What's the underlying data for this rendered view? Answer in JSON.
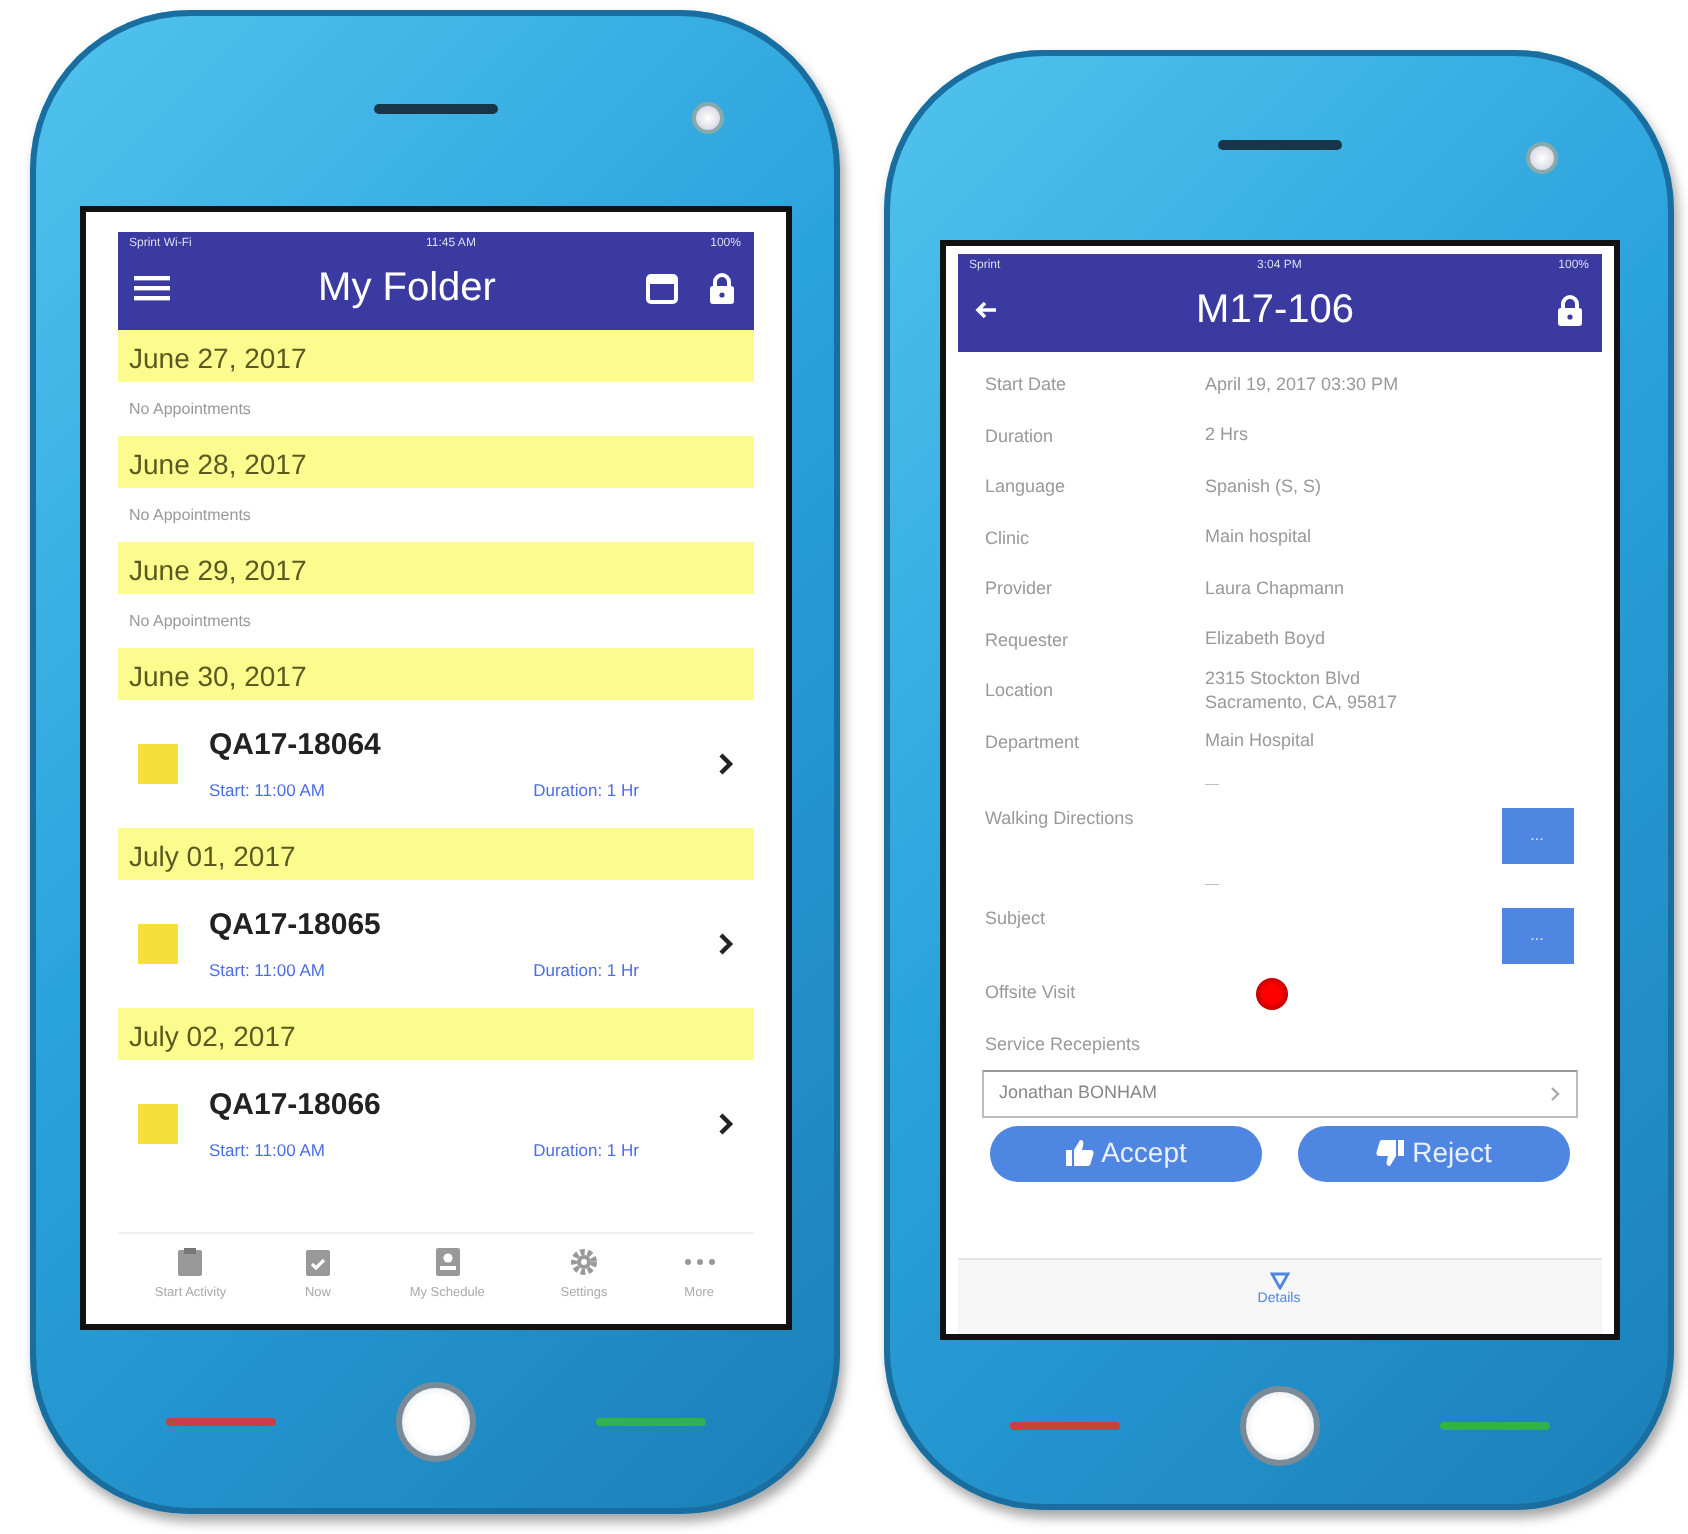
{
  "folder_screen": {
    "status_bar": {
      "carrier": "Sprint Wi-Fi",
      "time": "11:45 AM",
      "battery": "100%"
    },
    "title": "My Folder",
    "days": [
      {
        "date": "June 27, 2017",
        "empty_text": "No Appointments"
      },
      {
        "date": "June 28, 2017",
        "empty_text": "No Appointments"
      },
      {
        "date": "June 29, 2017",
        "empty_text": "No Appointments"
      },
      {
        "date": "June 30, 2017",
        "appointments": [
          {
            "id": "QA17-18064",
            "start": "Start: 11:00 AM",
            "duration": "Duration: 1 Hr",
            "color": "#f7df3a"
          }
        ]
      },
      {
        "date": "July 01, 2017",
        "appointments": [
          {
            "id": "QA17-18065",
            "start": "Start: 11:00 AM",
            "duration": "Duration: 1 Hr",
            "color": "#f7df3a"
          }
        ]
      },
      {
        "date": "July 02, 2017",
        "appointments": [
          {
            "id": "QA17-18066",
            "start": "Start: 11:00 AM",
            "duration": "Duration: 1 Hr",
            "color": "#f7df3a"
          }
        ]
      }
    ],
    "tabs": [
      {
        "label": "Start Activity"
      },
      {
        "label": "Now"
      },
      {
        "label": "My Schedule"
      },
      {
        "label": "Settings"
      },
      {
        "label": "More"
      }
    ]
  },
  "detail_screen": {
    "status_bar": {
      "carrier": "Sprint",
      "time": "3:04 PM",
      "battery": "100%"
    },
    "title": "M17-106",
    "fields": [
      {
        "kind": "text",
        "label": "Start Date",
        "value": "April 19, 2017    03:30 PM"
      },
      {
        "kind": "text",
        "label": "Duration",
        "value": "2 Hrs"
      },
      {
        "kind": "text",
        "label": "Language",
        "value": "Spanish (S, S)"
      },
      {
        "kind": "text",
        "label": "Clinic",
        "value": "Main hospital"
      },
      {
        "kind": "text",
        "label": "Provider",
        "value": "Laura Chapmann"
      },
      {
        "kind": "text",
        "label": "Requester",
        "value": "Elizabeth Boyd"
      },
      {
        "kind": "text",
        "label": "Location",
        "value": "2315 Stockton Blvd\nSacramento, CA, 95817"
      },
      {
        "kind": "text",
        "label": "Department",
        "value": "Main Hospital"
      },
      {
        "kind": "more",
        "label": "Walking Directions",
        "value": "—",
        "button": "..."
      },
      {
        "kind": "more",
        "label": "Subject",
        "value": "—",
        "button": "..."
      },
      {
        "kind": "toggle",
        "label": "Offsite Visit",
        "on": true
      }
    ],
    "recipients_label": "Service Recepients",
    "recipients": [
      "Jonathan BONHAM"
    ],
    "actions": [
      {
        "kind": "accept",
        "label": "Accept"
      },
      {
        "kind": "reject",
        "label": "Reject"
      }
    ],
    "footer_tab": "Details"
  }
}
